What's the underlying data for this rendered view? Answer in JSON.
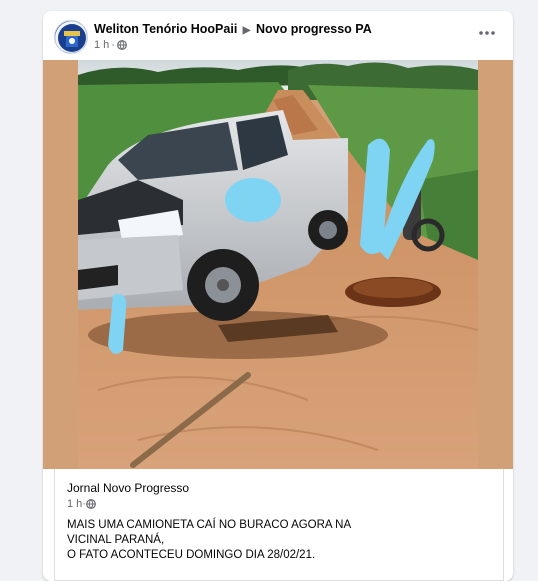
{
  "post": {
    "poster_name": "Weliton Tenório HooPaii",
    "arrow": "▶",
    "group_name": "Novo progresso PA",
    "time": "1 h",
    "separator": "·",
    "privacy_icon": "globe-icon",
    "more_icon": "more-options-icon"
  },
  "photo": {
    "blur_color": "#7fd3f3",
    "frame_color": "#d2a077"
  },
  "shared": {
    "source": "Jornal Novo Progresso",
    "time": "1 h",
    "separator": "·",
    "privacy_icon": "globe-icon",
    "text_lines": [
      "MAIS UMA CAMIONETA CAÍ NO BURACO AGORA NA",
      "VICINAL PARANÁ,",
      "O FATO ACONTECEU DOMINGO DIA 28/02/21."
    ]
  }
}
